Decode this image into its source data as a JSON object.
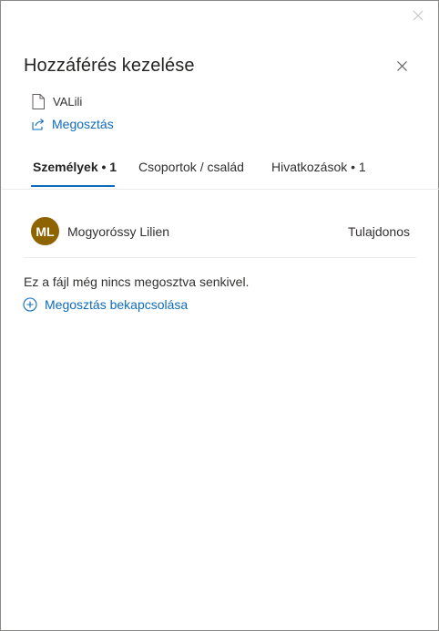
{
  "panel": {
    "title": "Hozzáférés kezelése",
    "file_name": "VALili",
    "share_label": "Megosztás"
  },
  "tabs": [
    {
      "label": "Személyek • 1",
      "active": true
    },
    {
      "label": "Csoportok / család",
      "active": false
    },
    {
      "label": "Hivatkozások • 1",
      "active": false
    }
  ],
  "people": [
    {
      "initials": "ML",
      "name": "Mogyoróssy Lilien",
      "role": "Tulajdonos",
      "avatar_color": "#8d6400"
    }
  ],
  "empty_state": {
    "message": "Ez a fájl még nincs megosztva senkivel.",
    "enable_label": "Megosztás bekapcsolása"
  },
  "colors": {
    "accent": "#0f6cbd",
    "text": "#323130",
    "divider": "#edebe9"
  },
  "icons": {
    "outer_close": "close-icon",
    "panel_close": "close-icon",
    "file": "document-icon",
    "share": "share-icon",
    "enable": "plus-circle-icon"
  }
}
